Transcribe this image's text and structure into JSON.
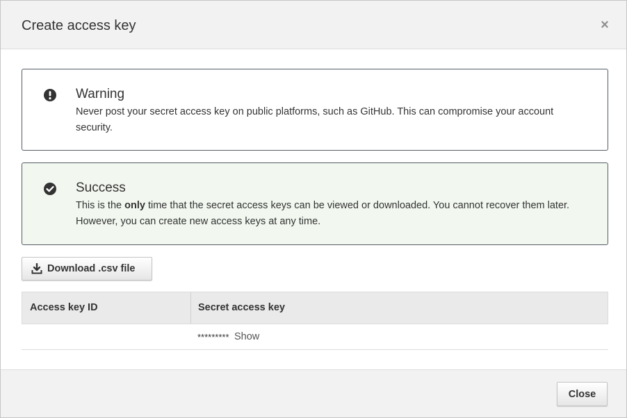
{
  "dialog": {
    "title": "Create access key",
    "close_symbol": "×"
  },
  "warning": {
    "icon": "exclamation-circle-icon",
    "heading": "Warning",
    "body": "Never post your secret access key on public platforms, such as GitHub. This can compromise your account security."
  },
  "success": {
    "icon": "check-circle-icon",
    "heading": "Success",
    "body_before": "This is the ",
    "body_bold": "only",
    "body_after": " time that the secret access keys can be viewed or downloaded. You cannot recover them later. However, you can create new access keys at any time."
  },
  "download_button": {
    "icon": "download-icon",
    "label": "Download .csv file"
  },
  "table": {
    "columns": [
      "Access key ID",
      "Secret access key"
    ],
    "rows": [
      {
        "access_key_id": "",
        "secret_mask": "*********",
        "show_label": "Show"
      }
    ]
  },
  "footer": {
    "close_label": "Close"
  },
  "colors": {
    "success_bg": "#f2f8f0",
    "border": "#545b64",
    "header_bg": "#f2f2f2"
  }
}
